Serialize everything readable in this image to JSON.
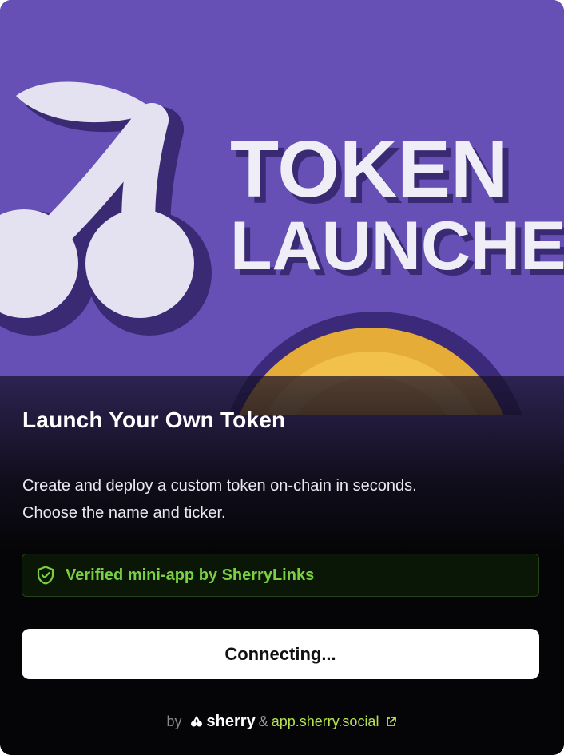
{
  "hero": {
    "headline_line1": "TOKEN",
    "headline_line2": "LAUNCHE"
  },
  "card": {
    "title": "Launch Your Own Token",
    "description_line1": "Create and deploy a custom token on-chain in seconds.",
    "description_line2": "Choose the name and ticker."
  },
  "verified": {
    "text": "Verified mini-app by SherryLinks",
    "icon": "shield-check-icon"
  },
  "action": {
    "button_label": "Connecting..."
  },
  "footer": {
    "by_label": "by",
    "brand": "sherry",
    "ampersand": "&",
    "link_text": "app.sherry.social",
    "link_icon": "external-link-icon"
  },
  "colors": {
    "hero_background": "#6650b6",
    "accent_green": "#79d142",
    "link_green": "#b6e24f",
    "coin_yellow": "#f2c14b",
    "dark": "#050507"
  }
}
